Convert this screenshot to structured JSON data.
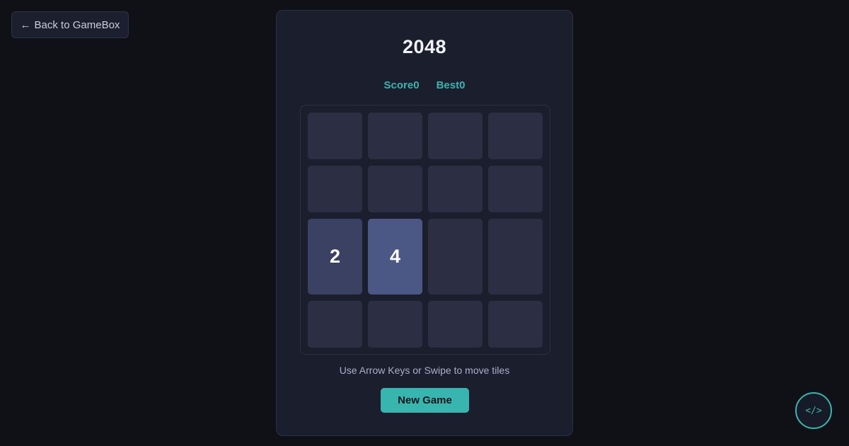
{
  "nav": {
    "back_arrow": "←",
    "back_label": "Back to GameBox"
  },
  "game": {
    "title": "2048",
    "score_label": "Score",
    "score_value": "0",
    "best_label": "Best",
    "best_value": "0",
    "grid": [
      [
        "",
        "",
        "",
        ""
      ],
      [
        "",
        "",
        "",
        ""
      ],
      [
        "2",
        "4",
        "",
        ""
      ],
      [
        "",
        "",
        "",
        ""
      ]
    ],
    "hint": "Use Arrow Keys or Swipe to move tiles",
    "new_game_label": "New Game"
  },
  "colors": {
    "accent": "#38b5ae",
    "empty_cell": "#2c2f44",
    "tile_2": "#3b4163",
    "tile_4": "#4b5785"
  },
  "code_button": {
    "icon": "code-icon",
    "label": "</>"
  }
}
